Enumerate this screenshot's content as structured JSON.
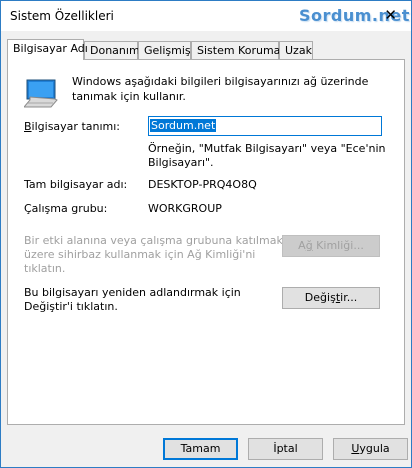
{
  "window": {
    "title": "Sistem Özellikleri",
    "watermark": "Sordum.net",
    "close_glyph": "✕"
  },
  "tabs": [
    {
      "label": "Bilgisayar Adı",
      "active": true
    },
    {
      "label": "Donanım",
      "active": false
    },
    {
      "label": "Gelişmiş",
      "active": false
    },
    {
      "label": "Sistem Koruması",
      "active": false
    },
    {
      "label": "Uzak",
      "active": false
    }
  ],
  "panel": {
    "icon": "computer-monitor-icon",
    "description": "Windows aşağıdaki bilgileri bilgisayarınızı ağ üzerinde tanımak için kullanır.",
    "computer_description_label": "Bilgisayar tanımı:",
    "computer_description_value": "Sordum.net",
    "example_hint": "Örneğin, \"Mutfak Bilgisayarı\" veya \"Ece'nin Bilgisayarı\".",
    "full_name_label": "Tam bilgisayar adı:",
    "full_name_value": "DESKTOP-PRQ4O8Q",
    "workgroup_label": "Çalışma grubu:",
    "workgroup_value": "WORKGROUP",
    "network_id_text": "Bir etki alanına veya çalışma grubuna katılmak üzere sihirbaz kullanmak için Ağ Kimliği'ni tıklatın.",
    "network_id_button": "Ağ Kimliği...",
    "rename_text": "Bu bilgisayarı yeniden adlandırmak için Değiştir'i tıklatın.",
    "change_button": "Değiştir..."
  },
  "footer": {
    "ok": "Tamam",
    "cancel": "İptal",
    "apply": "Uygula"
  },
  "colors": {
    "accent": "#0078d7",
    "watermark": "#4a8fd0"
  }
}
